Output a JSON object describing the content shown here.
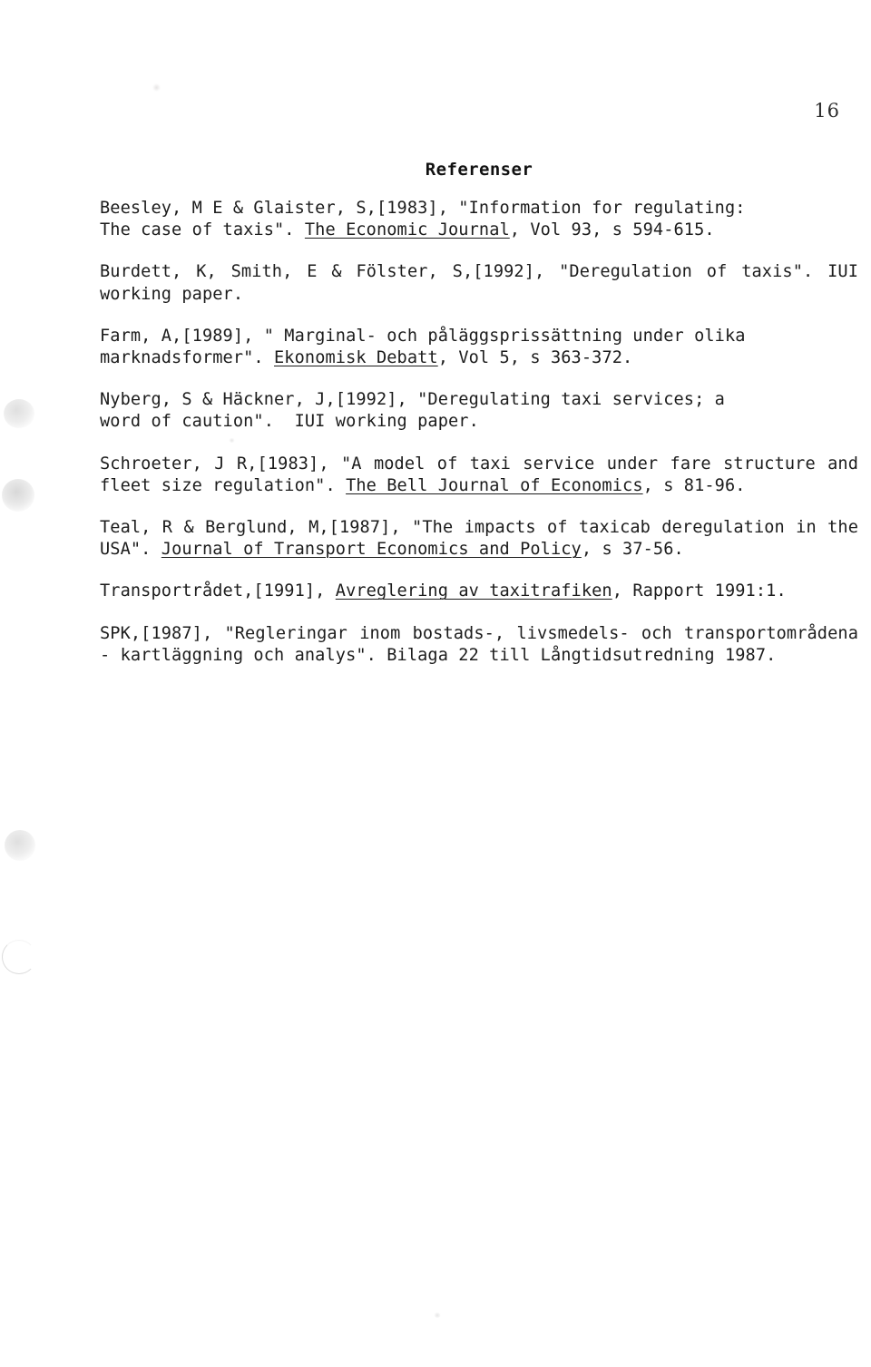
{
  "page": {
    "folio": "16",
    "heading": "Referenser"
  },
  "references": [
    {
      "id": "beesley",
      "justified": false,
      "parts": [
        {
          "text": "Beesley, M E & Glaister, S,[1983], \"Information for regulating:\nThe case of taxis\". ",
          "underline": false
        },
        {
          "text": "The Economic Journal",
          "underline": true
        },
        {
          "text": ", Vol 93, s 594-615.",
          "underline": false
        }
      ]
    },
    {
      "id": "burdett",
      "justified": true,
      "parts": [
        {
          "text": "Burdett, K, Smith, E & Fölster, S,[1992], \"Deregulation of taxis\". IUI working paper.",
          "underline": false
        }
      ]
    },
    {
      "id": "farm",
      "justified": false,
      "parts": [
        {
          "text": "Farm, A,[1989], \" Marginal- och påläggsprissättning under olika\nmarknadsformer\". ",
          "underline": false
        },
        {
          "text": "Ekonomisk Debatt",
          "underline": true
        },
        {
          "text": ", Vol 5, s 363-372.",
          "underline": false
        }
      ]
    },
    {
      "id": "nyberg",
      "justified": false,
      "parts": [
        {
          "text": "Nyberg, S & Häckner, J,[1992], \"Deregulating taxi services; a\nword of caution\".  IUI working paper.",
          "underline": false
        }
      ]
    },
    {
      "id": "schroeter",
      "justified": true,
      "parts": [
        {
          "text": "Schroeter, J R,[1983], \"A model of taxi service under fare structure and fleet size regulation\". ",
          "underline": false
        },
        {
          "text": "The Bell Journal of Economics",
          "underline": true
        },
        {
          "text": ", s 81-96.",
          "underline": false
        }
      ]
    },
    {
      "id": "teal",
      "justified": true,
      "parts": [
        {
          "text": "Teal, R & Berglund, M,[1987], \"The impacts of taxicab deregulation in the USA\". ",
          "underline": false
        },
        {
          "text": "Journal of Transport Economics and Policy",
          "underline": true
        },
        {
          "text": ", s 37-56.",
          "underline": false
        }
      ]
    },
    {
      "id": "transportradet",
      "justified": true,
      "parts": [
        {
          "text": "Transportrådet,[1991], ",
          "underline": false
        },
        {
          "text": "Avreglering av taxitrafiken",
          "underline": true
        },
        {
          "text": ", Rapport 1991:1.",
          "underline": false
        }
      ]
    },
    {
      "id": "spk",
      "justified": true,
      "parts": [
        {
          "text": "SPK,[1987], \"Regleringar inom bostads-, livsmedels- och transportområdena - kartläggning och analys\". Bilaga 22 till Långtidsutredning 1987.",
          "underline": false
        }
      ]
    }
  ]
}
